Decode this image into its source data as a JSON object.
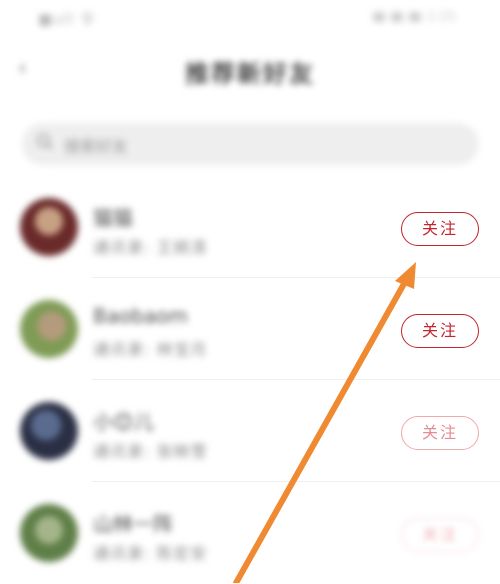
{
  "status_bar": {
    "carrier": "■ull 令",
    "time": "2:25"
  },
  "header": {
    "title": "推荐新好友"
  },
  "search": {
    "placeholder": "搜索好友"
  },
  "follow_label": "关注",
  "list": [
    {
      "name": "猫猫",
      "sub": "通讯录: 王婉清",
      "avatar_colors": [
        "#6a2a2a",
        "#c8a084"
      ]
    },
    {
      "name": "Baobaom",
      "sub": "通讯录: 林宝月",
      "avatar_colors": [
        "#7f9b55",
        "#b59b7d"
      ]
    },
    {
      "name": "小😊儿",
      "sub": "通讯录: 张映雪",
      "avatar_colors": [
        "#2b2f45",
        "#5a6b8f"
      ]
    },
    {
      "name": "山林一阵",
      "sub": "通讯录: 陈宏安",
      "avatar_colors": [
        "#5f7f48",
        "#a5b58a"
      ]
    }
  ],
  "accent_color": "#c4242c",
  "annotation_arrow_color": "#f08a32"
}
